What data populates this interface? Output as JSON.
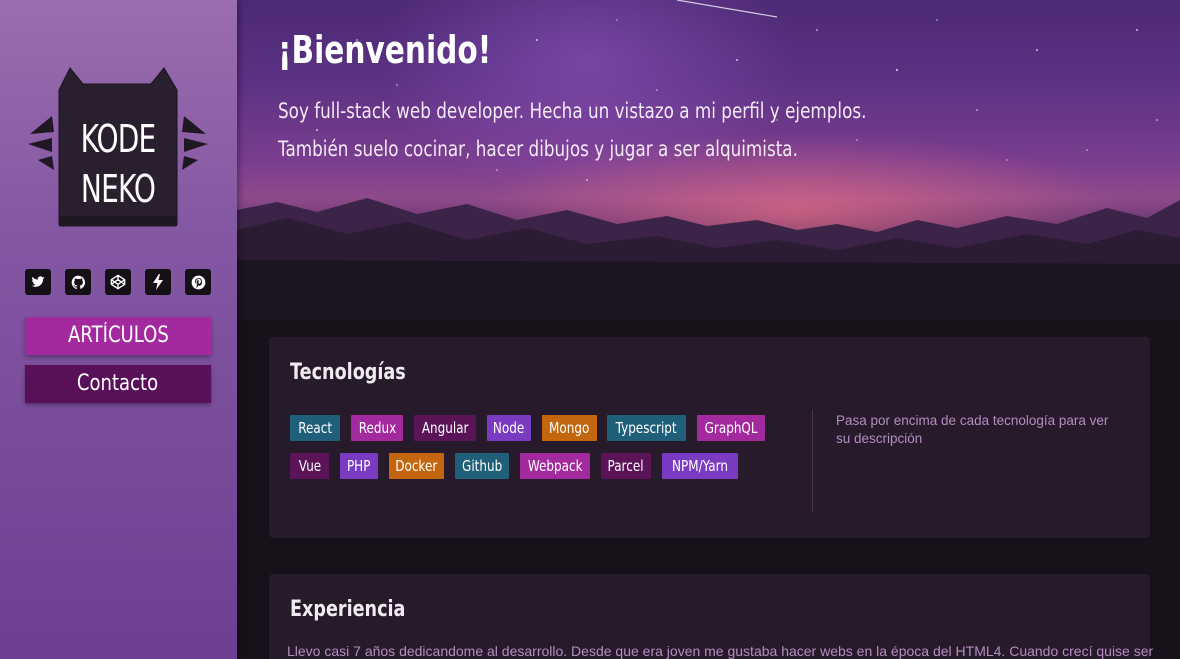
{
  "sidebar": {
    "logo": {
      "line1": "KODE",
      "line2": "NEKO"
    },
    "social": [
      {
        "name": "twitter-icon"
      },
      {
        "name": "github-icon"
      },
      {
        "name": "codepen-icon"
      },
      {
        "name": "lightning-icon"
      },
      {
        "name": "pinterest-icon"
      }
    ],
    "nav": {
      "articulos": "ARTÍCULOS",
      "contacto": "Contacto"
    }
  },
  "hero": {
    "title": "¡Bienvenido!",
    "line1": "Soy full-stack web developer. Hecha un vistazo a mi perfil y ejemplos.",
    "line2": "También suelo cocinar, hacer dibujos y jugar a ser alquimista."
  },
  "technologies": {
    "title": "Tecnologías",
    "tags": [
      {
        "label": "React",
        "color": "#1f5f7a"
      },
      {
        "label": "Redux",
        "color": "#a32a9e"
      },
      {
        "label": "Angular",
        "color": "#5a1457"
      },
      {
        "label": "Node",
        "color": "#7a3bc2"
      },
      {
        "label": "Mongo",
        "color": "#c4660e"
      },
      {
        "label": "Typescript",
        "color": "#1f5f7a"
      },
      {
        "label": "GraphQL",
        "color": "#a32a9e"
      },
      {
        "label": "Vue",
        "color": "#5a1457"
      },
      {
        "label": "PHP",
        "color": "#7a3bc2"
      },
      {
        "label": "Docker",
        "color": "#c4660e"
      },
      {
        "label": "Github",
        "color": "#1f5f7a"
      },
      {
        "label": "Webpack",
        "color": "#a32a9e"
      },
      {
        "label": "Parcel",
        "color": "#5a1457"
      },
      {
        "label": "NPM/Yarn",
        "color": "#7a3bc2"
      }
    ],
    "hint": "Pasa por encima de cada tecnología para ver su descripción"
  },
  "experience": {
    "title": "Experiencia",
    "text": "Llevo casi 7 años dedicandome al desarrollo. Desde que era joven me gustaba hacer webs en la época del HTML4. Cuando crecí quise ser"
  }
}
